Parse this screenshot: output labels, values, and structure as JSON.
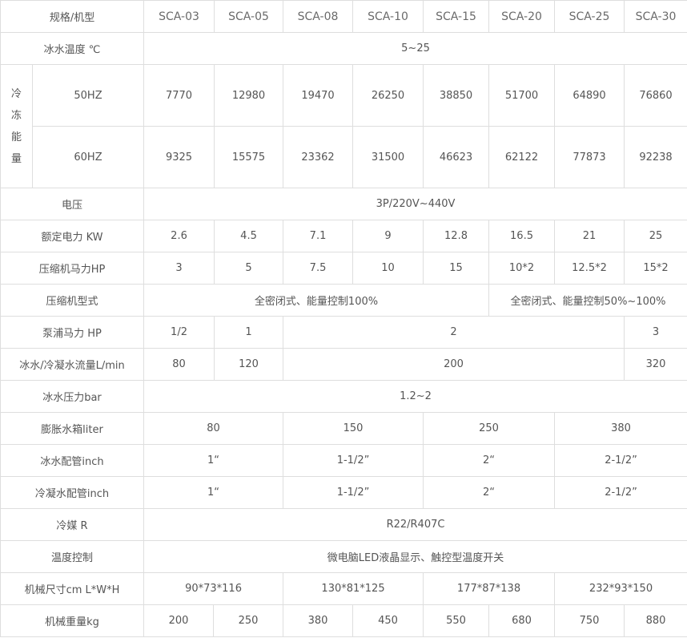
{
  "table": {
    "header_label": "规格/机型",
    "models": [
      "SCA-03",
      "SCA-05",
      "SCA-08",
      "SCA-10",
      "SCA-15",
      "SCA-20",
      "SCA-25",
      "SCA-30"
    ],
    "chilled_temp": {
      "label": "冰水温度 ℃",
      "value": "5~25"
    },
    "cooling": {
      "label_chars": [
        "冷",
        "冻",
        "能",
        "量"
      ],
      "rows": [
        {
          "label": "50HZ",
          "values": [
            "7770",
            "12980",
            "19470",
            "26250",
            "38850",
            "51700",
            "64890",
            "76860"
          ]
        },
        {
          "label": "60HZ",
          "values": [
            "9325",
            "15575",
            "23362",
            "31500",
            "46623",
            "62122",
            "77873",
            "92238"
          ]
        }
      ]
    },
    "voltage": {
      "label": "电压",
      "value": "3P/220V~440V"
    },
    "rated_power": {
      "label": "额定电力 KW",
      "values": [
        "2.6",
        "4.5",
        "7.1",
        "9",
        "12.8",
        "16.5",
        "21",
        "25"
      ]
    },
    "compressor_hp": {
      "label": "压缩机马力HP",
      "values": [
        "3",
        "5",
        "7.5",
        "10",
        "15",
        "10*2",
        "12.5*2",
        "15*2"
      ]
    },
    "compressor_type": {
      "label": "压缩机型式",
      "value_a": "全密闭式、能量控制100%",
      "value_b": "全密闭式、能量控制50%~100%"
    },
    "pump_hp": {
      "label": "泵浦马力 HP",
      "values": [
        "1/2",
        "1",
        "2",
        "3"
      ]
    },
    "flow": {
      "label": "冰水/冷凝水流量L/min",
      "values": [
        "80",
        "120",
        "200",
        "320"
      ]
    },
    "pressure": {
      "label": "冰水压力bar",
      "value": "1.2~2"
    },
    "tank": {
      "label": "膨胀水箱liter",
      "values": [
        "80",
        "150",
        "250",
        "380"
      ]
    },
    "chilled_pipe": {
      "label": "冰水配管inch",
      "values": [
        "1“",
        "1-1/2”",
        "2“",
        "2-1/2”"
      ]
    },
    "condenser_pipe": {
      "label": "冷凝水配管inch",
      "values": [
        "1“",
        "1-1/2”",
        "2“",
        "2-1/2”"
      ]
    },
    "refrigerant": {
      "label": "冷媒 R",
      "value": "R22/R407C"
    },
    "temp_control": {
      "label": "温度控制",
      "value": "微电脑LED液晶显示、触控型温度开关"
    },
    "dimensions": {
      "label": "机械尺寸cm L*W*H",
      "values": [
        "90*73*116",
        "130*81*125",
        "177*87*138",
        "232*93*150"
      ]
    },
    "weight": {
      "label": "机械重量kg",
      "values": [
        "200",
        "250",
        "380",
        "450",
        "550",
        "680",
        "750",
        "880"
      ]
    }
  }
}
